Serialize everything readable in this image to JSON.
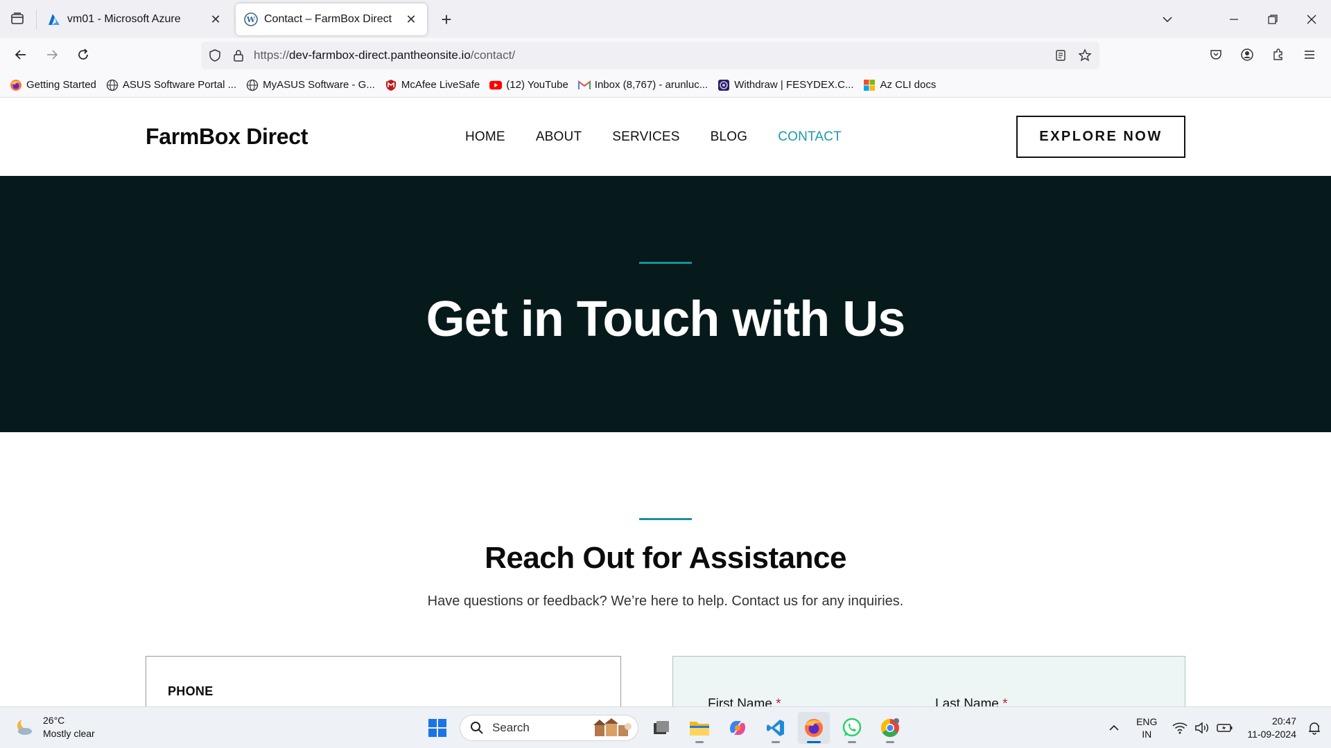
{
  "browser": {
    "tabs": [
      {
        "title": "vm01 - Microsoft Azure",
        "active": false
      },
      {
        "title": "Contact – FarmBox Direct",
        "active": true
      }
    ],
    "url": {
      "scheme": "https://",
      "host": "dev-farmbox-direct.pantheonsite.io",
      "path": "/contact/"
    },
    "bookmarks": [
      {
        "label": "Getting Started",
        "icon": "firefox-icon"
      },
      {
        "label": "ASUS Software Portal ...",
        "icon": "globe-icon"
      },
      {
        "label": "MyASUS Software - G...",
        "icon": "globe-icon"
      },
      {
        "label": "McAfee LiveSafe",
        "icon": "mcafee-icon"
      },
      {
        "label": "(12) YouTube",
        "icon": "youtube-icon"
      },
      {
        "label": "Inbox (8,767) - arunluc...",
        "icon": "gmail-icon"
      },
      {
        "label": "Withdraw | FESYDEX.C...",
        "icon": "fesydex-icon"
      },
      {
        "label": "Az CLI docs",
        "icon": "microsoft-icon"
      }
    ]
  },
  "site": {
    "logo": "FarmBox Direct",
    "menu": [
      {
        "label": "HOME",
        "current": false
      },
      {
        "label": "ABOUT",
        "current": false
      },
      {
        "label": "SERVICES",
        "current": false
      },
      {
        "label": "BLOG",
        "current": false
      },
      {
        "label": "CONTACT",
        "current": true
      }
    ],
    "cta": "EXPLORE NOW",
    "accent_color": "#1a9aa8",
    "hero_bg": "#061a1c"
  },
  "hero": {
    "title": "Get in Touch with Us"
  },
  "reach": {
    "title": "Reach Out for Assistance",
    "subtitle": "Have questions or feedback? We’re here to help. Contact us for any inquiries."
  },
  "contact_info": {
    "phone_label": "PHONE"
  },
  "form": {
    "first_name_label": "First Name",
    "last_name_label": "Last Name",
    "required_mark": "*"
  },
  "taskbar": {
    "weather": {
      "temp": "26°C",
      "condition": "Mostly clear"
    },
    "search_placeholder": "Search",
    "pinned": [
      "file-explorer-icon",
      "folder-icon",
      "copilot-icon",
      "vscode-icon",
      "firefox-icon",
      "whatsapp-icon",
      "chrome-icon"
    ],
    "language": {
      "line1": "ENG",
      "line2": "IN"
    },
    "clock": {
      "time": "20:47",
      "date": "11-09-2024"
    }
  }
}
